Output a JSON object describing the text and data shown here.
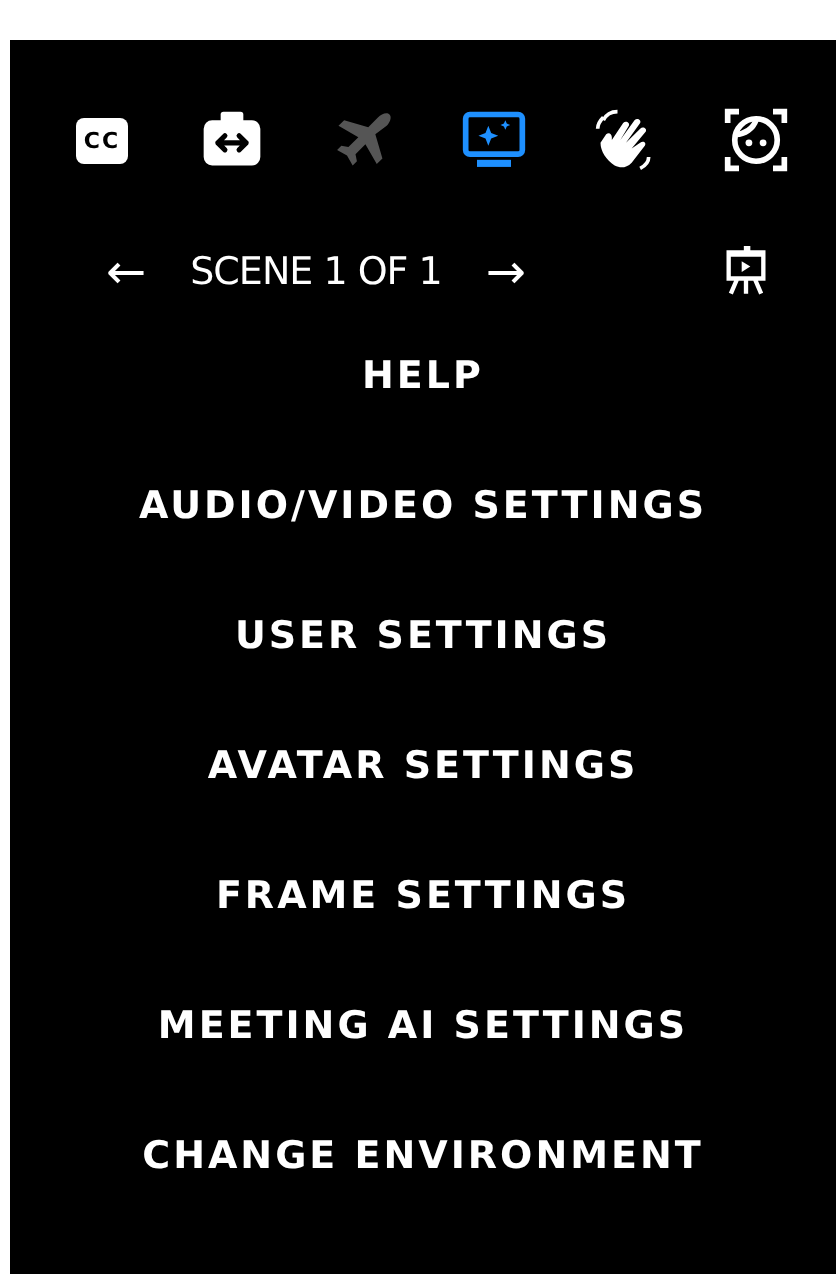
{
  "toolbar": [
    {
      "kind": "captions",
      "label": "CC",
      "active": false,
      "disabled": false
    },
    {
      "kind": "swap",
      "active": false,
      "disabled": false
    },
    {
      "kind": "airplane",
      "active": false,
      "disabled": true
    },
    {
      "kind": "screen",
      "active": true,
      "disabled": false
    },
    {
      "kind": "wave",
      "active": false,
      "disabled": false
    },
    {
      "kind": "face",
      "active": false,
      "disabled": false
    }
  ],
  "scene": {
    "previous": "←",
    "label": "SCENE 1 OF 1",
    "next": "→"
  },
  "menu": [
    {
      "label": "HELP"
    },
    {
      "label": "AUDIO/VIDEO SETTINGS"
    },
    {
      "label": "USER SETTINGS"
    },
    {
      "label": "AVATAR SETTINGS"
    },
    {
      "label": "FRAME SETTINGS"
    },
    {
      "label": "MEETING AI SETTINGS"
    },
    {
      "label": "CHANGE ENVIRONMENT"
    }
  ]
}
